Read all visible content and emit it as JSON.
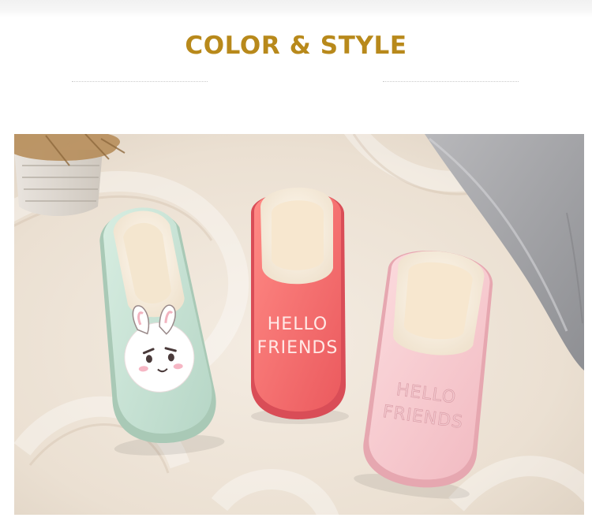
{
  "banner": {
    "title": "COLOR & STYLE"
  },
  "photo": {
    "slipper_green_animal": "bunny",
    "slipper_coral_text_line1": "HELLO",
    "slipper_coral_text_line2": "FRIENDS",
    "slipper_pink_text_line1": "HELLO",
    "slipper_pink_text_line2": "FRIENDS"
  },
  "colors": {
    "title_gold": "#b8891b",
    "mint": "#cfe8da",
    "coral": "#f36b6b",
    "light_pink": "#f7c8cf",
    "fleece": "#fff7ee",
    "rug": "#eee4d8"
  }
}
